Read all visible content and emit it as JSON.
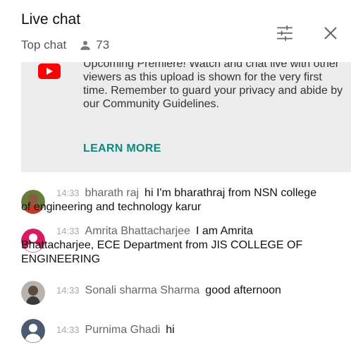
{
  "header": {
    "title": "Live chat",
    "mode": "Top chat",
    "viewer_count": "73"
  },
  "notice": {
    "text": "Upcoming Premiere! Watch and chat live with other viewers as this upload is shown for the very first time. Remember to guard your privacy and abide by our Community Guidelines.",
    "learn_more": "LEARN MORE"
  },
  "messages": [
    {
      "time": "14:33",
      "author": "bharath raj",
      "text_first": "hi I'm bharathraj from NSN college",
      "text_rest": "of engineering and technology karur",
      "avatar_color": "#6a7a3a"
    },
    {
      "time": "14:33",
      "author": "Amrita Bhattacharjee",
      "text_first": "I am Amrita",
      "text_rest": "Bhattacharjee, ECE Department from JIS COLLEGE OF ENGINEERING",
      "avatar_color": "#d81b60"
    },
    {
      "time": "14:33",
      "author": "Sonali sharma Sharma",
      "text_first": "good afternoon",
      "text_rest": "",
      "avatar_color": "#8a7f78"
    },
    {
      "time": "14:33",
      "author": "Purnima Ghadi",
      "text_first": "hi",
      "text_rest": "",
      "avatar_color": "#4a5b6e"
    }
  ]
}
